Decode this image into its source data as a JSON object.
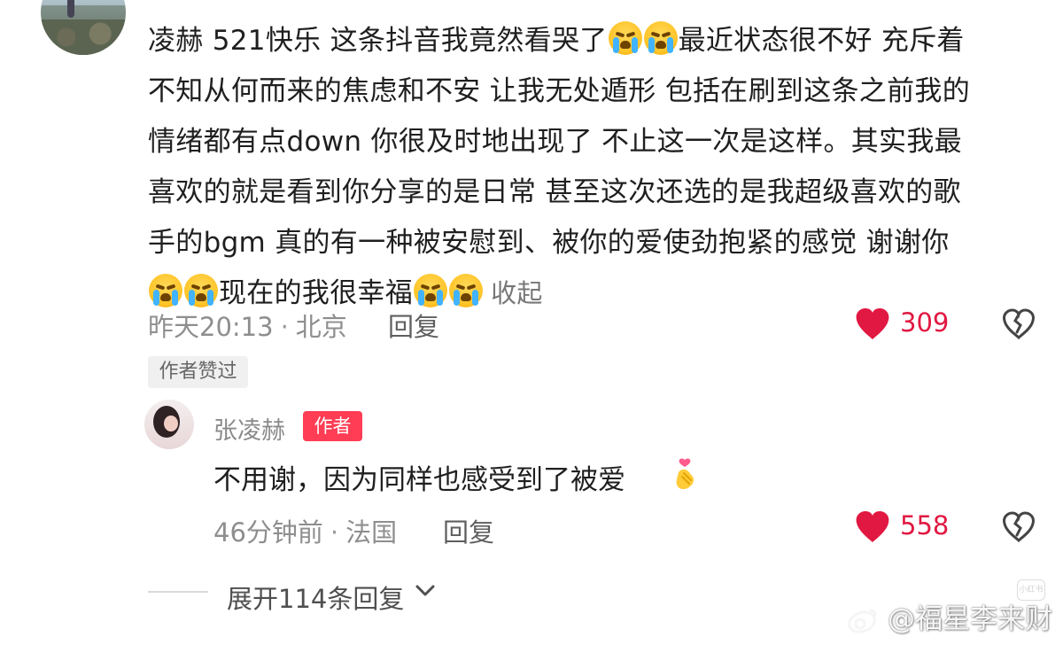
{
  "comment": {
    "line1_a": "凌赫 521快乐 这条抖音我竟然看哭了",
    "line1_b": "最近状态很不好 充斥着",
    "line2": "不知从何而来的焦虑和不安 让我无处遁形 包括在刷到这条之前我的",
    "line3": "情绪都有点down 你很及时地出现了 不止这一次是这样。其实我最",
    "line4": "喜欢的就是看到你分享的是日常 甚至这次还选的是我超级喜欢的歌",
    "line5": "手的bgm 真的有一种被安慰到、被你的爱使劲抱紧的感觉 谢谢你",
    "line6": "现在的我很幸福",
    "collapse": "收起",
    "time": "昨天20:13",
    "location": "北京",
    "reply": "回复",
    "likes": "309",
    "author_liked": "作者赞过"
  },
  "reply_comment": {
    "author": "张凌赫",
    "tag": "作者",
    "text": "不用谢，因为同样也感受到了被爱",
    "time": "46分钟前",
    "location": "法国",
    "reply": "回复",
    "likes": "558"
  },
  "expand": {
    "text": "展开114条回复"
  },
  "watermark": {
    "text": "@福星李来财"
  },
  "small_badge": "小红书",
  "colors": {
    "like": "#e11842",
    "author_tag": "#ff3d55",
    "meta": "#8e8e8e"
  },
  "icons": {
    "emoji": "crying-face-icon",
    "like": "heart-icon",
    "dislike": "broken-heart-icon",
    "expand": "chevron-down-icon",
    "watermark": "weibo-icon",
    "reply_emoji": "hand-heart-icon"
  }
}
